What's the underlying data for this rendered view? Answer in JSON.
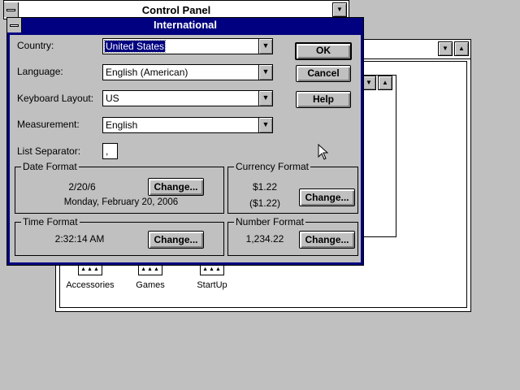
{
  "background": {
    "control_panel_title": "Control Panel",
    "program_groups": [
      {
        "label": "Accessories"
      },
      {
        "label": "Games"
      },
      {
        "label": "StartUp"
      }
    ]
  },
  "dialog": {
    "title": "International",
    "fields": {
      "country_label": "Country:",
      "country_value": "United States",
      "language_label": "Language:",
      "language_value": "English (American)",
      "keyboard_label": "Keyboard Layout:",
      "keyboard_value": "US",
      "measurement_label": "Measurement:",
      "measurement_value": "English",
      "list_separator_label": "List Separator:",
      "list_separator_value": ","
    },
    "buttons": {
      "ok": "OK",
      "cancel": "Cancel",
      "help": "Help",
      "change": "Change..."
    },
    "date_format": {
      "title": "Date Format",
      "short": "2/20/6",
      "long": "Monday, February 20, 2006"
    },
    "currency_format": {
      "title": "Currency Format",
      "positive": "$1.22",
      "negative": "($1.22)"
    },
    "time_format": {
      "title": "Time Format",
      "value": "2:32:14 AM"
    },
    "number_format": {
      "title": "Number Format",
      "value": "1,234.22"
    }
  },
  "colors": {
    "desktop": "#c0c0c0",
    "title_active": "#000080",
    "title_inactive": "#ffffff"
  }
}
